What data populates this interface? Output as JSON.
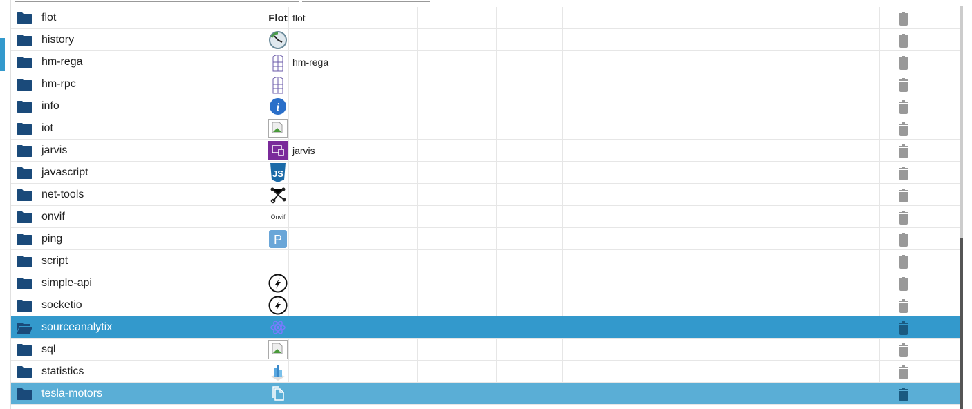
{
  "colors": {
    "selected": "#3399cc",
    "hover": "#5aaed6",
    "folder": "#1a4a7a",
    "trash": "#999999"
  },
  "rows": [
    {
      "name": "flot",
      "icon": "flot-logo",
      "title": "flot"
    },
    {
      "name": "history",
      "icon": "clock-icon",
      "title": ""
    },
    {
      "name": "hm-rega",
      "icon": "homematic-icon",
      "title": "hm-rega"
    },
    {
      "name": "hm-rpc",
      "icon": "homematic-icon",
      "title": ""
    },
    {
      "name": "info",
      "icon": "info-icon",
      "title": ""
    },
    {
      "name": "iot",
      "icon": "broken-image-icon",
      "title": ""
    },
    {
      "name": "jarvis",
      "icon": "jarvis-icon",
      "title": "jarvis"
    },
    {
      "name": "javascript",
      "icon": "js-icon",
      "title": ""
    },
    {
      "name": "net-tools",
      "icon": "network-icon",
      "title": ""
    },
    {
      "name": "onvif",
      "icon": "onvif-logo",
      "title": ""
    },
    {
      "name": "ping",
      "icon": "ping-icon",
      "title": ""
    },
    {
      "name": "script",
      "icon": "",
      "title": ""
    },
    {
      "name": "simple-api",
      "icon": "socket-icon",
      "title": ""
    },
    {
      "name": "socketio",
      "icon": "socket-icon",
      "title": ""
    },
    {
      "name": "sourceanalytix",
      "icon": "atom-icon",
      "title": "",
      "state": "selected"
    },
    {
      "name": "sql",
      "icon": "broken-image-icon",
      "title": ""
    },
    {
      "name": "statistics",
      "icon": "chart-icon",
      "title": ""
    },
    {
      "name": "tesla-motors",
      "icon": "copy-icon",
      "title": "",
      "state": "hover"
    }
  ],
  "logos": {
    "flot": "Flot",
    "onvif": "Onvif",
    "js": "JS",
    "ping": "P"
  }
}
